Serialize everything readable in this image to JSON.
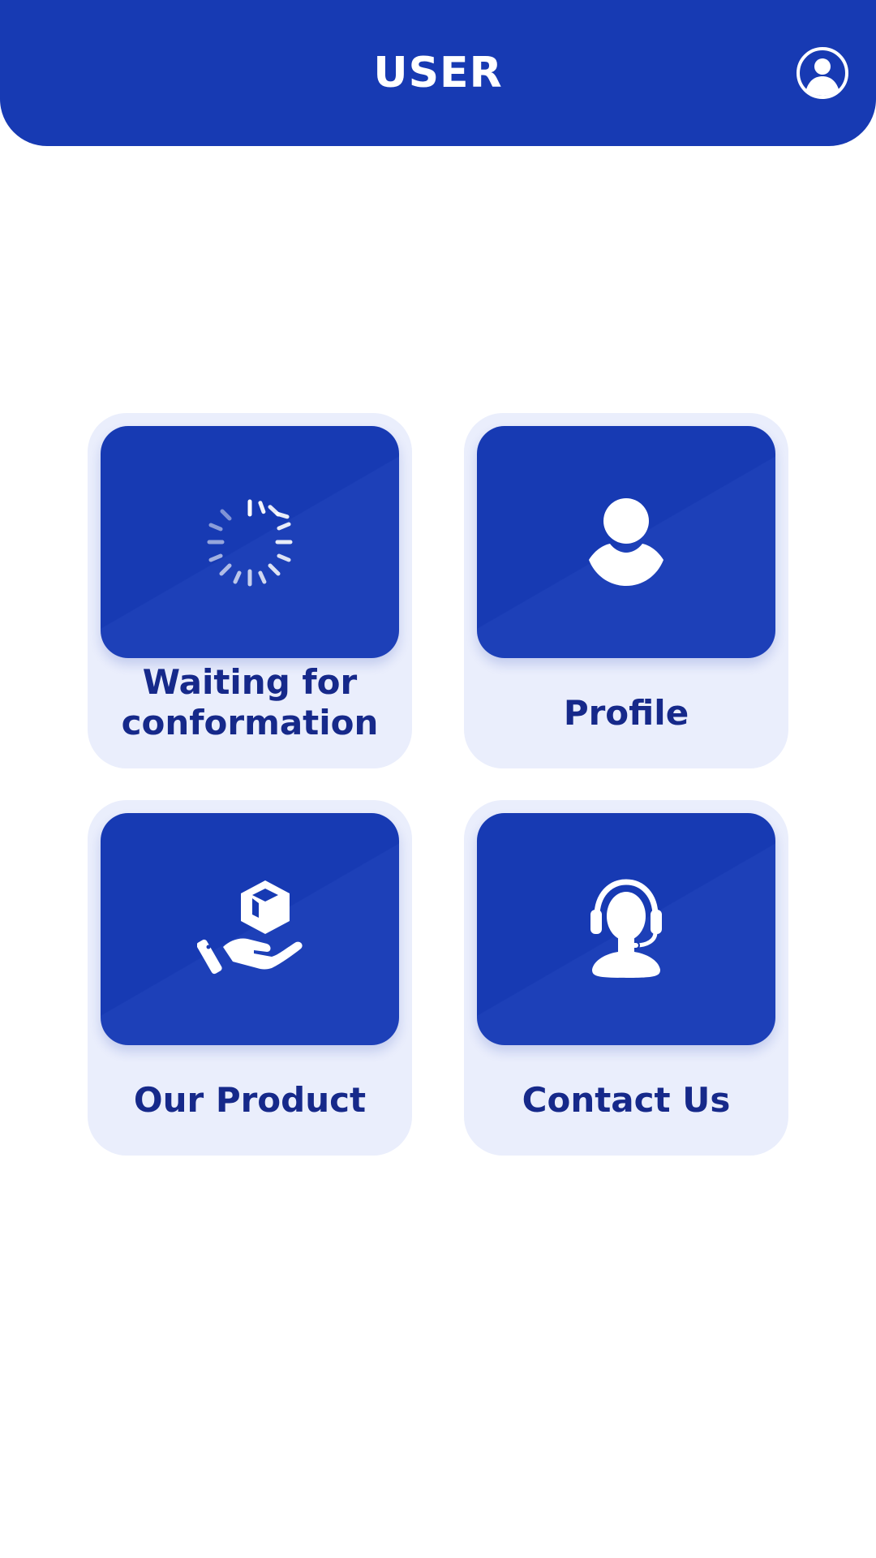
{
  "header": {
    "title": "USER",
    "account_icon": "user-circle-icon"
  },
  "tiles": [
    {
      "label_line1": "Waiting for",
      "label_line2": "conformation",
      "icon": "loading-spinner-icon"
    },
    {
      "label": "Profile",
      "icon": "person-icon"
    },
    {
      "label": "Our Product",
      "icon": "hand-box-icon"
    },
    {
      "label": "Contact Us",
      "icon": "headset-support-icon"
    }
  ],
  "colors": {
    "primary": "#173ab3",
    "tile_background": "#eaeefc",
    "label_text": "#16298a",
    "page_background": "#ffffff"
  }
}
